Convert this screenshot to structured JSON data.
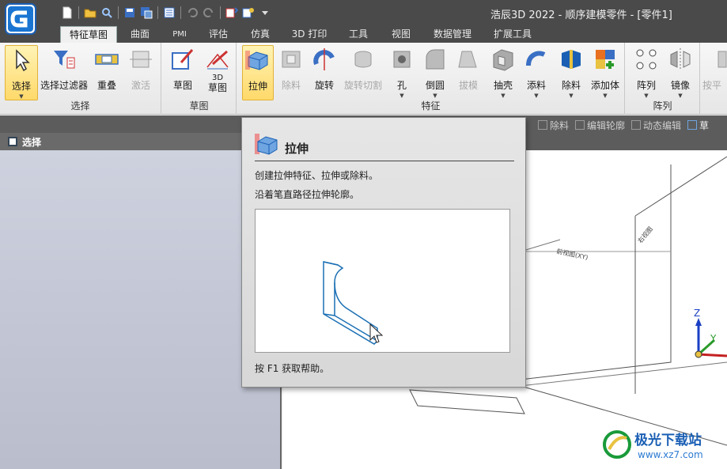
{
  "window": {
    "title": "浩辰3D 2022 - 顺序建模零件 - [零件1]"
  },
  "tabs": [
    {
      "label": "特征草图"
    },
    {
      "label": "曲面"
    },
    {
      "label": "PMI"
    },
    {
      "label": "评估"
    },
    {
      "label": "仿真"
    },
    {
      "label": "3D 打印"
    },
    {
      "label": "工具"
    },
    {
      "label": "视图"
    },
    {
      "label": "数据管理"
    },
    {
      "label": "扩展工具"
    }
  ],
  "ribbon": {
    "groups": {
      "select": "选择",
      "sketch": "草图",
      "feature": "特征",
      "pattern": "阵列"
    },
    "buttons": {
      "select": "选择",
      "select_filter": "选择过滤器",
      "overlap": "重叠",
      "activate": "激活",
      "sketch": "草图",
      "sketch3d_top": "3D",
      "sketch3d_bottom": "草图",
      "extrude": "拉伸",
      "cut": "除料",
      "revolve": "旋转",
      "revolve_cut": "旋转切割",
      "hole": "孔",
      "round": "倒圆",
      "draft": "拔模",
      "shell": "抽壳",
      "add_material": "添料",
      "remove_material": "除料",
      "add_body": "添加体",
      "pattern": "阵列",
      "mirror": "镜像",
      "flatten": "按平"
    }
  },
  "strip": {
    "items": [
      "除料",
      "编辑轮廓",
      "动态编辑",
      "草"
    ]
  },
  "panel": {
    "title": "选择"
  },
  "tooltip": {
    "title": "拉伸",
    "desc1": "创建拉伸特征、拉伸或除料。",
    "desc2": "沿着笔直路径拉伸轮廓。",
    "help": "按 F1 获取帮助。"
  },
  "viewport": {
    "plane_xy": "前视图(XY)",
    "plane_side": "右视图",
    "axis_z": "Z",
    "axis_y": "Y"
  },
  "watermark": {
    "line1": "极光下载站",
    "line2": "www.xz7.com"
  },
  "colors": {
    "accent": "#ffd96a",
    "titlebar": "#4a4a4a",
    "link_blue": "#1a5fb4"
  }
}
